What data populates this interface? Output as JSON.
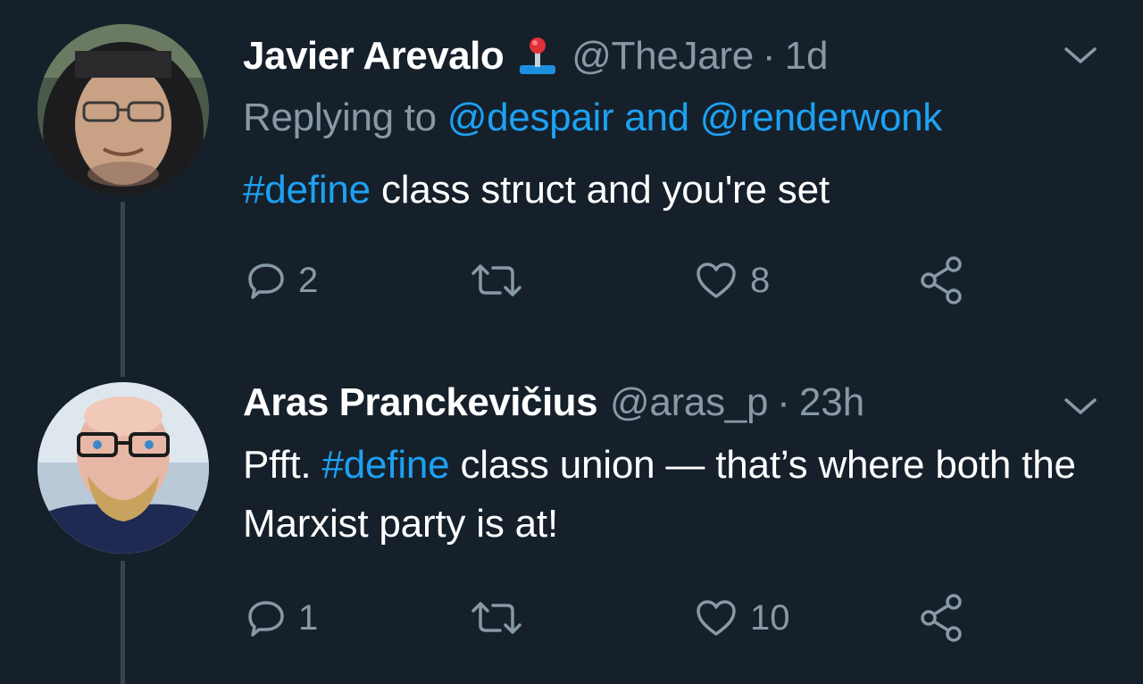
{
  "tweets": [
    {
      "author_name": "Javier Arevalo",
      "author_emoji_icon": "joystick-icon",
      "handle": "@TheJare",
      "separator": "·",
      "time": "1d",
      "replying_prefix": "Replying to",
      "replying_mention_1": "@despair",
      "replying_joiner": "and",
      "replying_mention_2": "@renderwonk",
      "text_hashtag": "#define",
      "text_rest": " class struct and you're set",
      "reply_count": "2",
      "retweet_count": "",
      "like_count": "8"
    },
    {
      "author_name": "Aras Pranckevičius",
      "handle": "@aras_p",
      "separator": "·",
      "time": "23h",
      "text_prefix": "Pfft. ",
      "text_hashtag": "#define",
      "text_rest": " class union — that’s where both the Marxist party is at!",
      "reply_count": "1",
      "retweet_count": "",
      "like_count": "10"
    }
  ],
  "colors": {
    "background": "#15202b",
    "text_primary": "#ffffff",
    "text_secondary": "#8899a6",
    "accent": "#1da1f2",
    "thread_line": "#38444d"
  },
  "icons": [
    "reply-icon",
    "retweet-icon",
    "like-icon",
    "share-icon",
    "chevron-down-icon"
  ]
}
